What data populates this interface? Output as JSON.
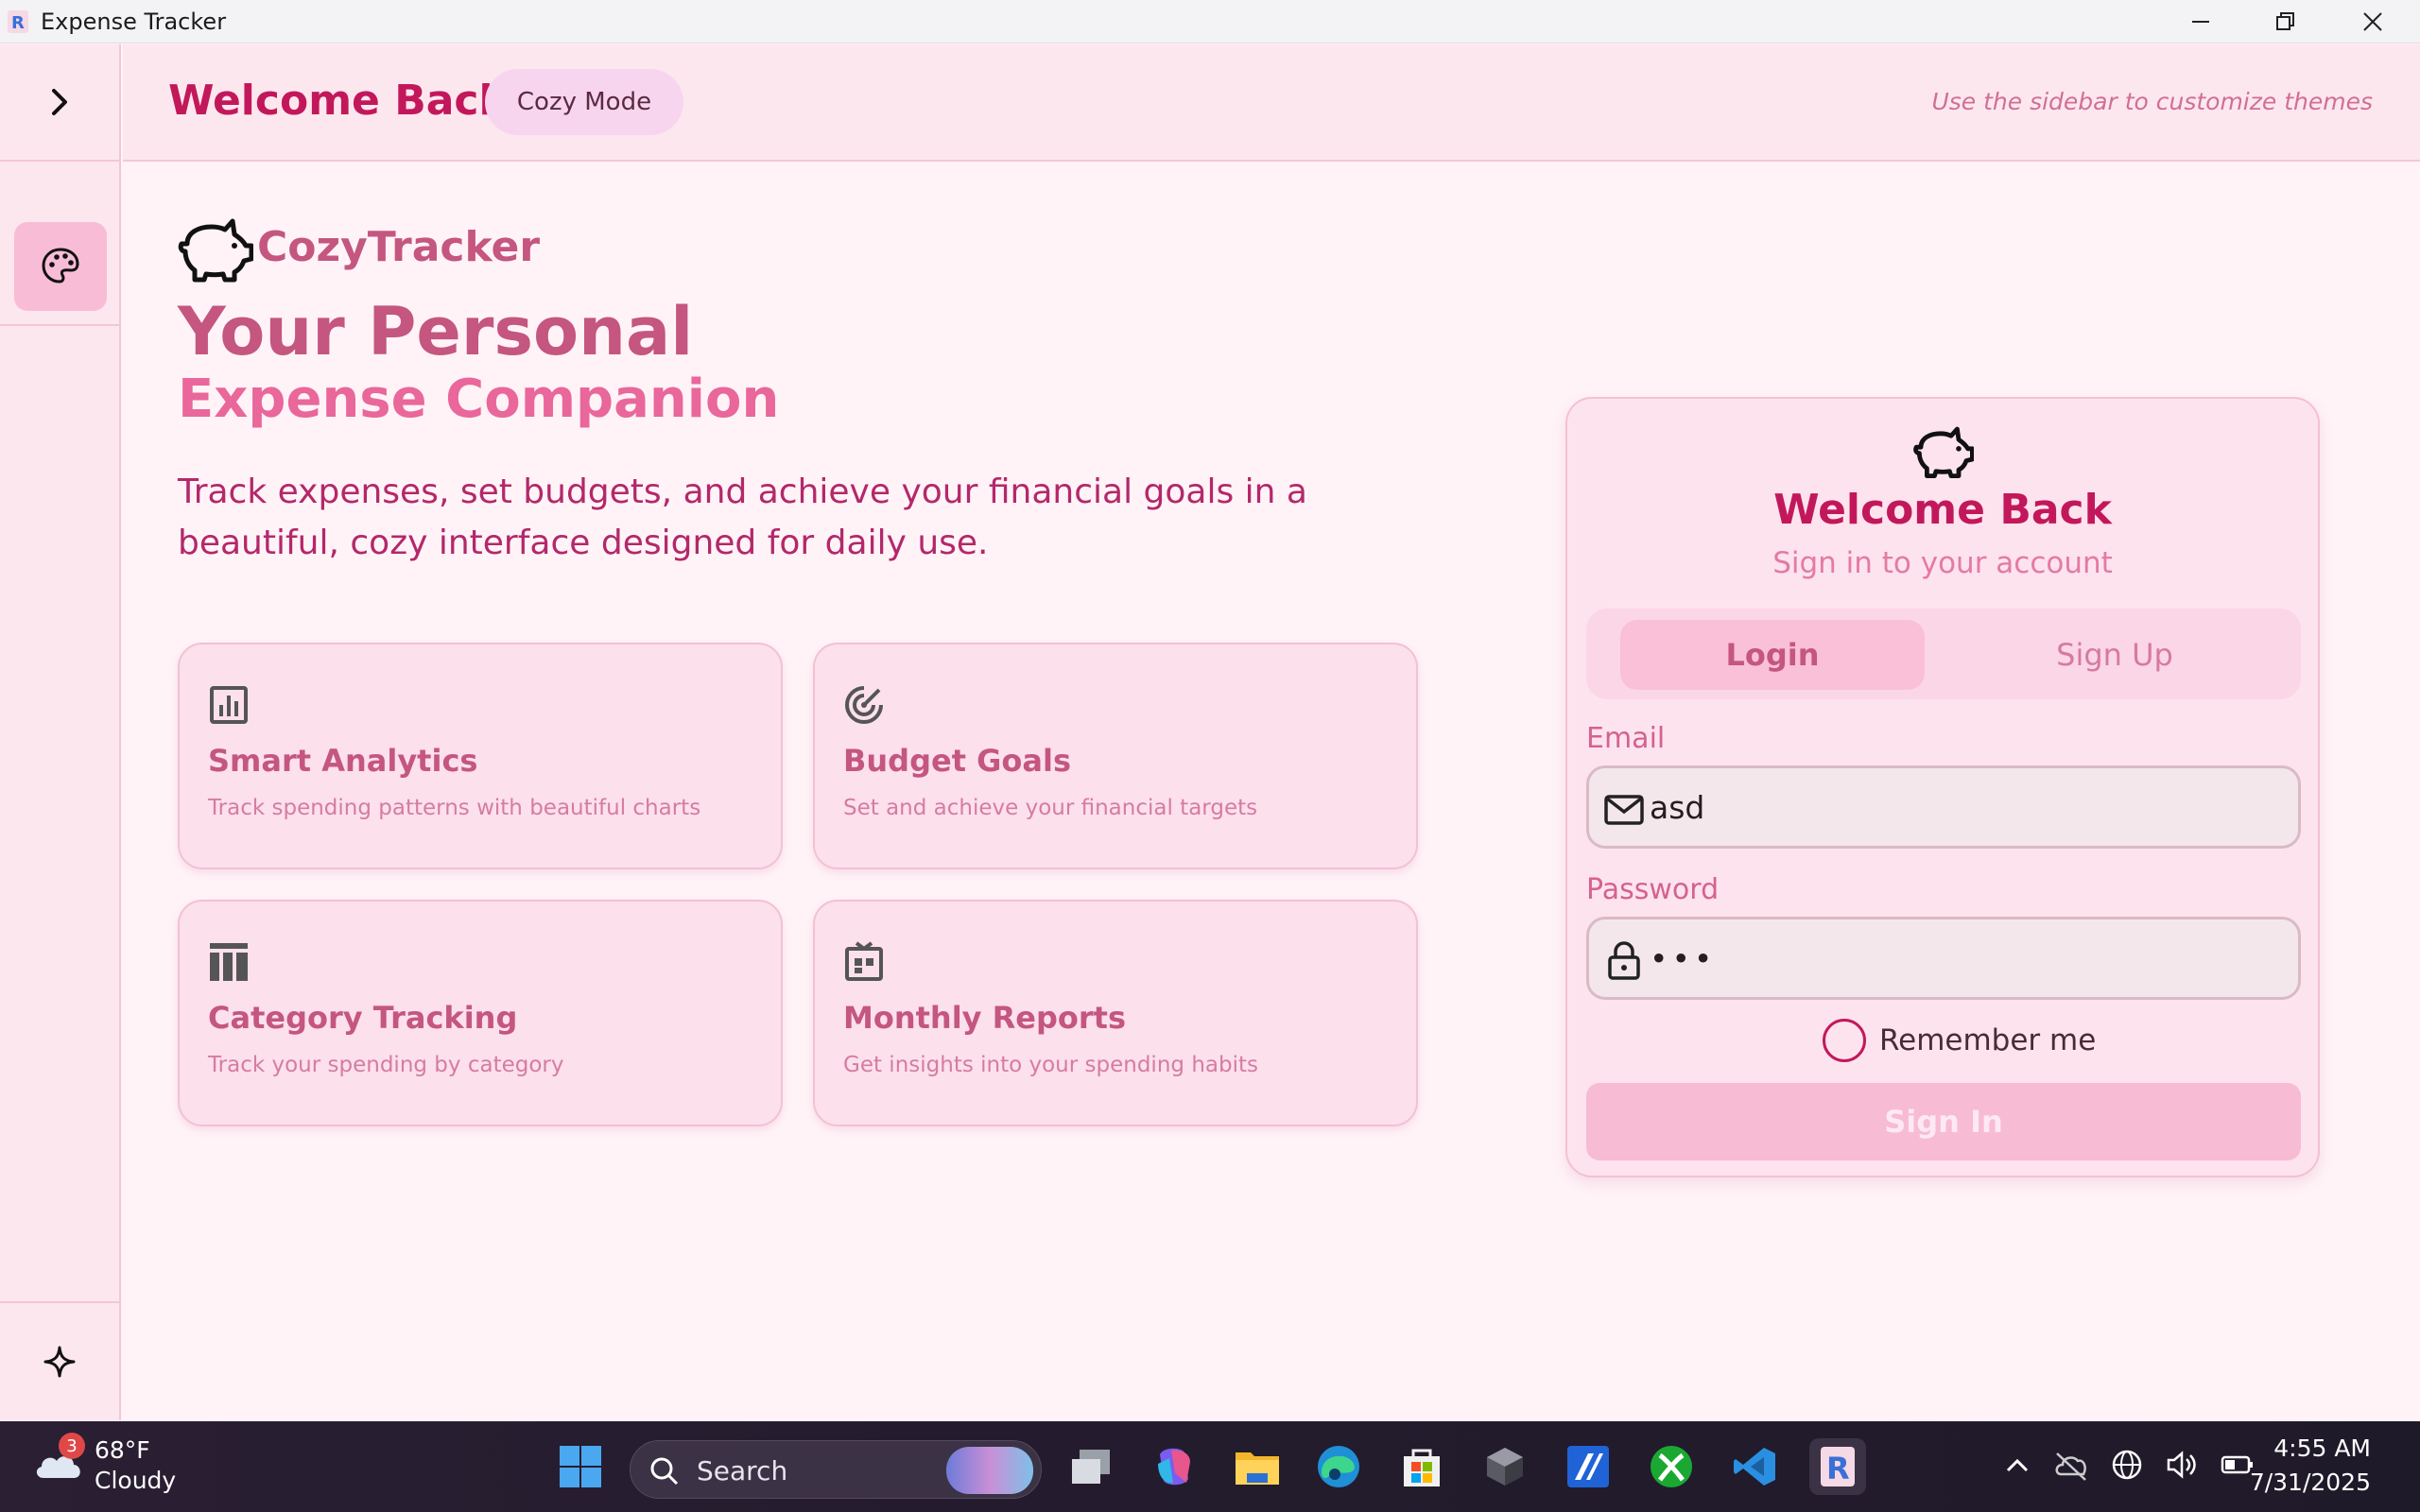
{
  "window": {
    "title": "Expense Tracker"
  },
  "header": {
    "title": "Welcome Back",
    "mode_pill": "Cozy Mode",
    "hint": "Use the sidebar to customize themes"
  },
  "hero": {
    "brand": "CozyTracker",
    "headline_1": "Your Personal",
    "headline_2": "Expense Companion",
    "description": "Track expenses, set budgets, and achieve your financial goals in a beautiful, cozy interface designed for daily use."
  },
  "features": [
    {
      "title": "Smart Analytics",
      "desc": "Track spending patterns with beautiful charts",
      "icon": "analytics-icon"
    },
    {
      "title": "Budget Goals",
      "desc": "Set and achieve your financial targets",
      "icon": "target-icon"
    },
    {
      "title": "Category Tracking",
      "desc": "Track your spending by category",
      "icon": "category-icon"
    },
    {
      "title": "Monthly Reports",
      "desc": "Get insights into your spending habits",
      "icon": "report-icon"
    }
  ],
  "login": {
    "title": "Welcome Back",
    "subtitle": "Sign in to your account",
    "tab_login": "Login",
    "tab_signup": "Sign Up",
    "email_label": "Email",
    "email_value": "asd",
    "password_label": "Password",
    "password_value": "•••",
    "remember_label": "Remember me",
    "submit": "Sign In"
  },
  "taskbar": {
    "weather_temp": "68°F",
    "weather_cond": "Cloudy",
    "weather_badge": "3",
    "search_placeholder": "Search",
    "time": "4:55 AM",
    "date": "7/31/2025"
  },
  "colors": {
    "accent": "#c2185b",
    "background": "#fff3f7",
    "card": "#fce0ec"
  }
}
